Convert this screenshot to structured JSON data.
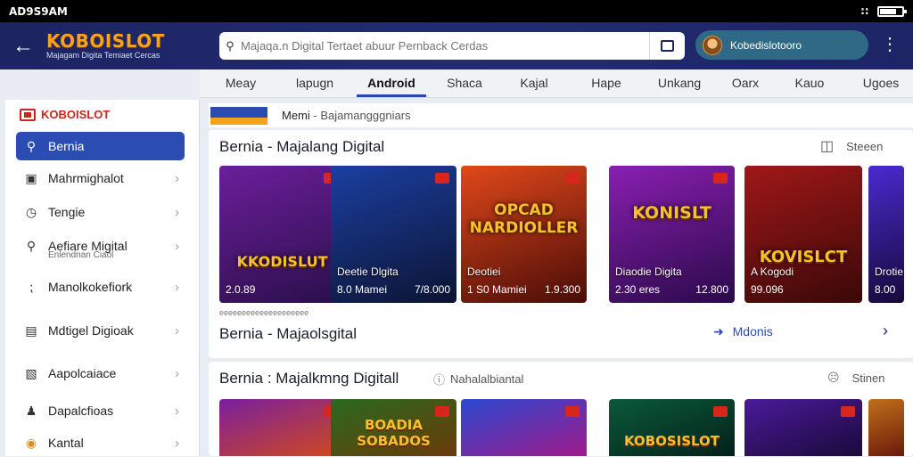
{
  "status": {
    "time": "AD9S9AM"
  },
  "appbar": {
    "brand": "KOBOISLOT",
    "tagline": "Majagam Digita Temiaet Cercas",
    "search_placeholder": "Majaqa.n Digital Tertaet abuur Pernback Cerdas",
    "user_name": "Kobedislotooro"
  },
  "tabs": [
    "Meay",
    "lapugn",
    "Android",
    "Shaca",
    "Kajal",
    "Hape",
    "Unkang",
    "Oarx",
    "Kauo",
    "Ugoes"
  ],
  "active_tab": 2,
  "sidebar": {
    "title": "KOBOISLOT",
    "items": [
      {
        "label": "Bernia",
        "icon": "search-icon",
        "active": true
      },
      {
        "label": "Mahrmighalot",
        "icon": "window-icon"
      },
      {
        "label": "Tengie",
        "icon": "clock-icon"
      },
      {
        "label": "Aefiare Migital",
        "sub": "Enlendnan Ciaol",
        "icon": "magnifier-icon"
      },
      {
        "label": "Manolkokefiork",
        "icon": "wifi-icon"
      },
      {
        "label": "Mdtigel Digioak",
        "icon": "calendar-icon"
      },
      {
        "label": "Aapolcaiace",
        "icon": "chat-icon"
      },
      {
        "label": "Dapalcfioas",
        "icon": "person-icon"
      },
      {
        "label": "Kantal",
        "icon": "coin-icon"
      }
    ]
  },
  "main": {
    "crumb_left": "Memi",
    "crumb_right": "Bajamangggniars",
    "section1": {
      "title": "Bernia - Majalang Digital",
      "right_label": "Steeen",
      "cards": [
        {
          "big": "KKODISLUT",
          "title": "",
          "left": "2.0.89",
          "right": ""
        },
        {
          "big": "",
          "title": "Deetie Dlgita",
          "left": "8.0 Mamei",
          "right": "7/8.000"
        },
        {
          "big": "OPCAD NARDIOLLER",
          "title": "Deotiei",
          "left": "1 S0 Mamiei",
          "right": "1.9.300"
        },
        {
          "big": "KONISLT",
          "title": "Diaodie Digita",
          "left": "2.30 eres",
          "right": "12.800"
        },
        {
          "big": "KOVISLCT",
          "title": "A Kogodi",
          "left": "99.096",
          "right": ""
        },
        {
          "big": "",
          "title": "Drotie",
          "left": "8.00",
          "right": ""
        }
      ],
      "tiny": "eeeeeeeeeeeeeeeeeeee",
      "footer_title": "Bernia - Majaolsgital",
      "more": "Mdonis"
    },
    "section2": {
      "title": "Bernia : Majalkmng Digitall",
      "mid_label": "Nahalalbiantal",
      "right_label": "Stinen",
      "cards": [
        {
          "big": ""
        },
        {
          "big": "BOADIA SOBADOS"
        },
        {
          "big": ""
        },
        {
          "big": "KOBOSISLOT"
        },
        {
          "big": ""
        },
        {
          "big": ""
        }
      ]
    }
  }
}
